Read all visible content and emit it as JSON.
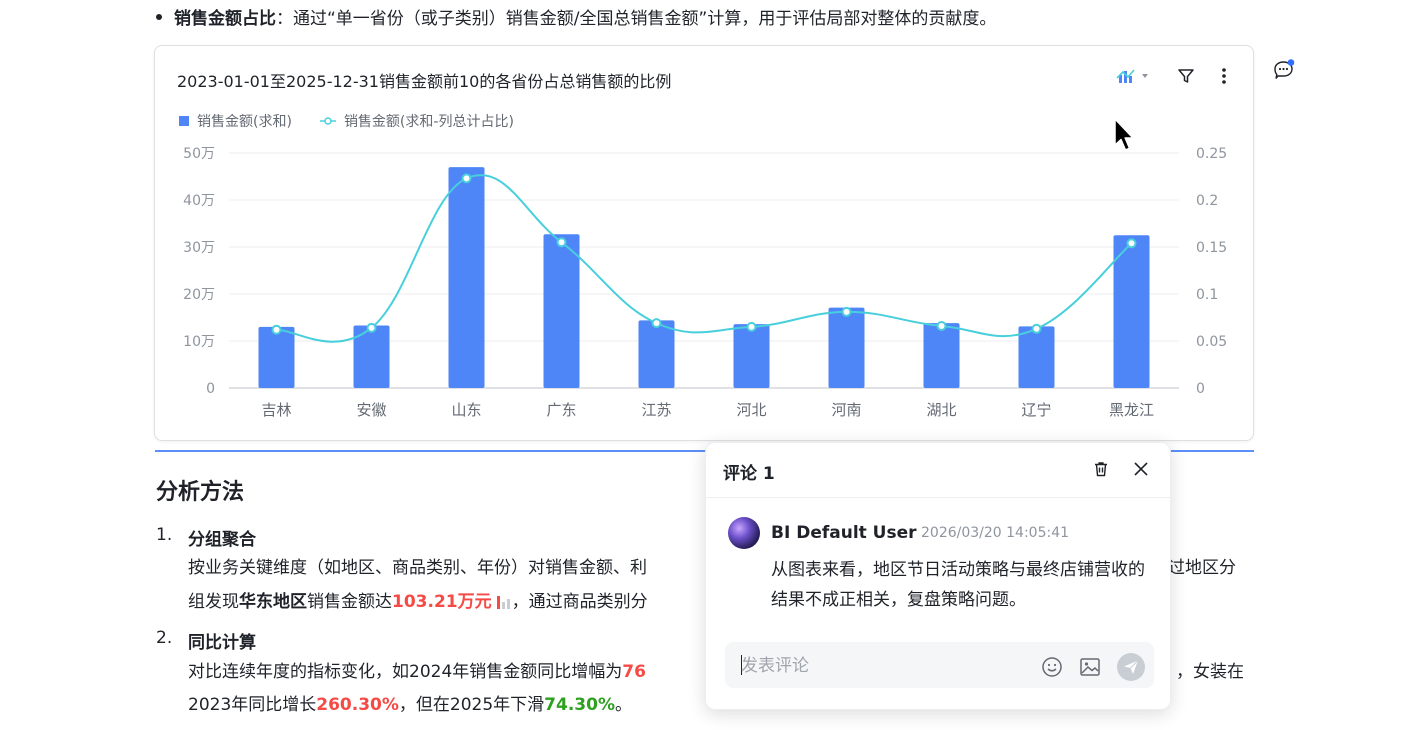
{
  "doc": {
    "bullet_bold": "销售金额占比",
    "bullet_rest": "：通过“单一省份（或子类别）销售金额/全国总销售金额”计算，用于评估局部对整体的贡献度。",
    "section_title": "分析方法",
    "item1_num": "1.",
    "item1_title": "分组聚合",
    "item1_line1": "按业务关键维度（如地区、商品类别、年份）对销售金额、利",
    "item1_line1_tail": "过地区分",
    "item1_line2_a": "组发现",
    "item1_line2_bold": "华东地区",
    "item1_line2_b": "销售金额达",
    "item1_line2_red": "103.21万元",
    "item1_line2_c": "，通过商品类别分",
    "item2_num": "2.",
    "item2_title": "同比计算",
    "item2_line1": "对比连续年度的指标变化，如2024年销售金额同比增幅为",
    "item2_line1_red": "76",
    "item2_line1_tail": "，女装在",
    "item2_line2_a": "2023年同比增长",
    "item2_line2_red": "260.30%",
    "item2_line2_b": "，但在2025年下滑",
    "item2_line2_green": "74.30%",
    "item2_line2_c": "。"
  },
  "chart_card": {
    "title": "2023-01-01至2025-12-31销售金额前10的各省份占总销售额的比例",
    "tools": {
      "chart_type_icon": "line-bar-chart-icon",
      "filter_icon": "filter-icon",
      "more_icon": "more-vertical-icon"
    }
  },
  "chart_data": {
    "type": "bar",
    "categories": [
      "吉林",
      "安徽",
      "山东",
      "广东",
      "江苏",
      "河北",
      "河南",
      "湖北",
      "辽宁",
      "黑龙江"
    ],
    "series": [
      {
        "name": "销售金额(求和)",
        "type": "bar",
        "axis": "left",
        "color": "#4f86f7",
        "values": [
          130000,
          133000,
          470000,
          327000,
          144000,
          136000,
          171000,
          138000,
          131000,
          325000
        ]
      },
      {
        "name": "销售金额(求和-列总计占比)",
        "type": "line",
        "axis": "right",
        "color": "#48cfdc",
        "values": [
          0.062,
          0.064,
          0.223,
          0.155,
          0.069,
          0.065,
          0.081,
          0.066,
          0.063,
          0.154
        ]
      }
    ],
    "y_left": {
      "ticks": [
        "0",
        "10万",
        "20万",
        "30万",
        "40万",
        "50万"
      ],
      "lim": [
        0,
        500000
      ]
    },
    "y_right": {
      "ticks": [
        "0",
        "0.05",
        "0.1",
        "0.15",
        "0.2",
        "0.25"
      ],
      "lim": [
        0,
        0.25
      ]
    },
    "legend_position": "top-left",
    "grid": true
  },
  "comment_panel": {
    "title": "评论 1",
    "user": "BI Default User",
    "time": "2026/03/20 14:05:41",
    "text": "从图表来看，地区节日活动策略与最终店铺营收的结果不成正相关，复盘策略问题。",
    "input_placeholder": "发表评论",
    "icons": [
      "delete-icon",
      "close-icon",
      "emoji-icon",
      "image-icon",
      "send-icon"
    ]
  },
  "colors": {
    "bar": "#4f86f7",
    "line": "#48cfdc",
    "accent": "#5b8ff9",
    "positive": "#f54a45",
    "negative": "#2ea121"
  }
}
